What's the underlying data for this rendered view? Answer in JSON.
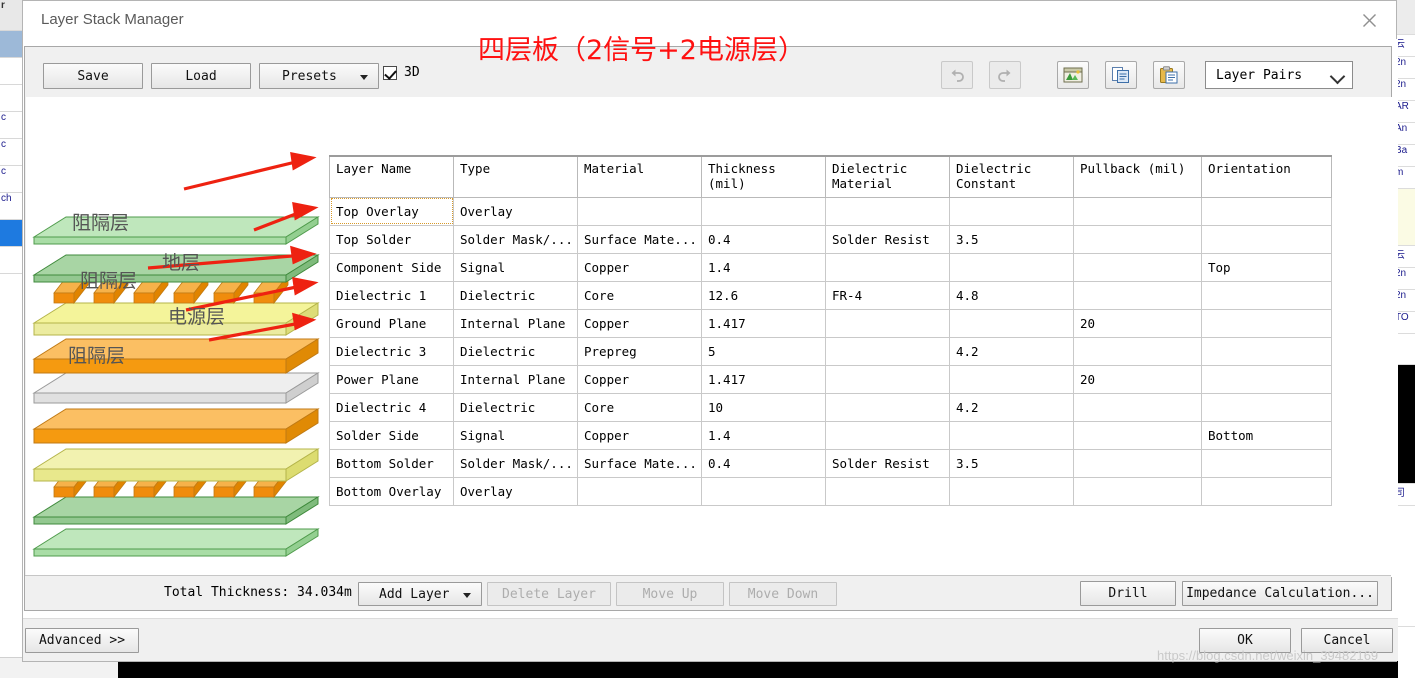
{
  "window": {
    "title": "Layer Stack Manager",
    "close_icon": "close-icon"
  },
  "annotation": {
    "heading": "四层板（2信号+2电源层）",
    "heading_color": "#ff1111",
    "callouts": [
      {
        "label": "阻隔层"
      },
      {
        "label": "地层"
      },
      {
        "label": "阻隔层"
      },
      {
        "label": "电源层"
      },
      {
        "label": "阻隔层"
      }
    ],
    "arrow_color": "#ee2211"
  },
  "toolbar": {
    "save_label": "Save",
    "load_label": "Load",
    "presets_label": "Presets",
    "checkbox_3d_label": "3D",
    "checkbox_3d_checked": true,
    "undo_icon": "undo-icon",
    "redo_icon": "redo-icon",
    "import_icon": "import-image-icon",
    "copy_icon": "copy-icon",
    "paste_icon": "paste-icon",
    "layer_pairs_value": "Layer Pairs"
  },
  "table": {
    "columns": [
      "Layer Name",
      "Type",
      "Material",
      "Thickness\n(mil)",
      "Dielectric\nMaterial",
      "Dielectric\nConstant",
      "Pullback (mil)",
      "Orientation"
    ],
    "rows": [
      {
        "name": "Top Overlay",
        "type": "Overlay",
        "material": "",
        "thickness": "",
        "diel_material": "",
        "diel_constant": "",
        "pullback": "",
        "orientation": "",
        "selected": true
      },
      {
        "name": "Top Solder",
        "type": "Solder Mask/...",
        "material": "Surface Mate...",
        "thickness": "0.4",
        "diel_material": "Solder Resist",
        "diel_constant": "3.5",
        "pullback": "",
        "orientation": "",
        "selected": false
      },
      {
        "name": "Component Side",
        "type": "Signal",
        "material": "Copper",
        "thickness": "1.4",
        "diel_material": "",
        "diel_constant": "",
        "pullback": "",
        "orientation": "Top",
        "selected": false
      },
      {
        "name": "Dielectric 1",
        "type": "Dielectric",
        "material": "Core",
        "thickness": "12.6",
        "diel_material": "FR-4",
        "diel_constant": "4.8",
        "pullback": "",
        "orientation": "",
        "selected": false
      },
      {
        "name": "Ground Plane",
        "type": "Internal Plane",
        "material": "Copper",
        "thickness": "1.417",
        "diel_material": "",
        "diel_constant": "",
        "pullback": "20",
        "orientation": "",
        "selected": false
      },
      {
        "name": "Dielectric 3",
        "type": "Dielectric",
        "material": "Prepreg",
        "thickness": "5",
        "diel_material": "",
        "diel_constant": "4.2",
        "pullback": "",
        "orientation": "",
        "selected": false
      },
      {
        "name": "Power Plane",
        "type": "Internal Plane",
        "material": "Copper",
        "thickness": "1.417",
        "diel_material": "",
        "diel_constant": "",
        "pullback": "20",
        "orientation": "",
        "selected": false
      },
      {
        "name": "Dielectric 4",
        "type": "Dielectric",
        "material": "Core",
        "thickness": "10",
        "diel_material": "",
        "diel_constant": "4.2",
        "pullback": "",
        "orientation": "",
        "selected": false
      },
      {
        "name": "Solder Side",
        "type": "Signal",
        "material": "Copper",
        "thickness": "1.4",
        "diel_material": "",
        "diel_constant": "",
        "pullback": "",
        "orientation": "Bottom",
        "selected": false
      },
      {
        "name": "Bottom Solder",
        "type": "Solder Mask/...",
        "material": "Surface Mate...",
        "thickness": "0.4",
        "diel_material": "Solder Resist",
        "diel_constant": "3.5",
        "pullback": "",
        "orientation": "",
        "selected": false
      },
      {
        "name": "Bottom Overlay",
        "type": "Overlay",
        "material": "",
        "thickness": "",
        "diel_material": "",
        "diel_constant": "",
        "pullback": "",
        "orientation": "",
        "selected": false
      }
    ]
  },
  "bottom_bar": {
    "total_thickness": "Total Thickness: 34.034m",
    "add_layer_label": "Add Layer",
    "delete_layer_label": "Delete Layer",
    "move_up_label": "Move Up",
    "move_down_label": "Move Down",
    "drill_label": "Drill",
    "impedance_label": "Impedance Calculation..."
  },
  "footer": {
    "advanced_label": "Advanced >>",
    "ok_label": "OK",
    "cancel_label": "Cancel"
  },
  "watermark": "https://blog.csdn.net/weixin_39482169"
}
